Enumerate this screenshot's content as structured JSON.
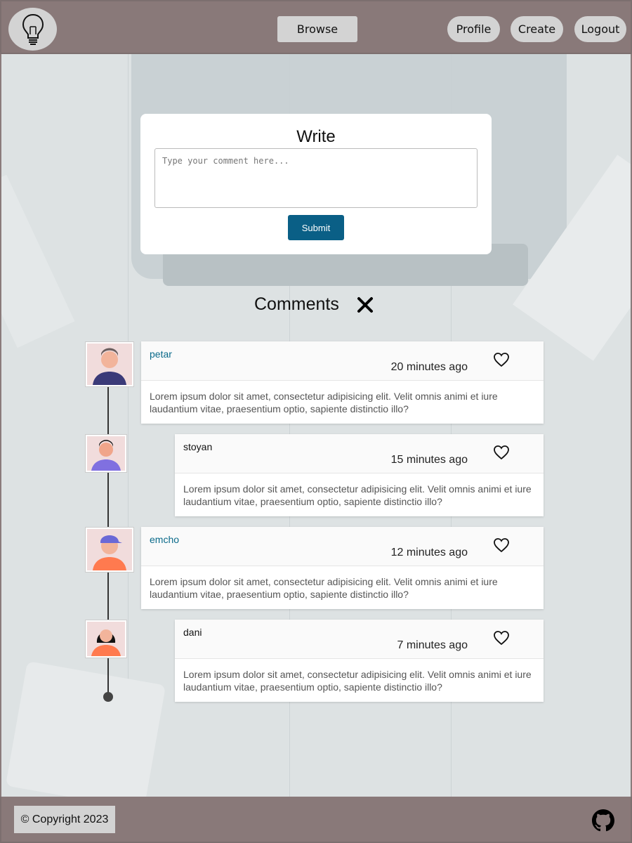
{
  "header": {
    "nav": {
      "browse": "Browse",
      "profile": "Profile",
      "create": "Create",
      "logout": "Logout"
    },
    "logo_icon": "lightbulb-icon"
  },
  "write": {
    "title": "Write",
    "placeholder": "Type your comment here...",
    "submit": "Submit"
  },
  "comments": {
    "title": "Comments",
    "close_icon": "close-icon",
    "items": [
      {
        "user": "petar",
        "time": "20 minutes ago",
        "text": "Lorem ipsum dolor sit amet, consectetur adipisicing elit. Velit omnis animi et iure laudantium vitae, praesentium optio, sapiente distinctio illo?",
        "user_color": "#0a6a8a"
      },
      {
        "user": "stoyan",
        "time": "15 minutes ago",
        "text": "Lorem ipsum dolor sit amet, consectetur adipisicing elit. Velit omnis animi et iure laudantium vitae, praesentium optio, sapiente distinctio illo?",
        "user_color": "#111111"
      },
      {
        "user": "emcho",
        "time": "12 minutes ago",
        "text": "Lorem ipsum dolor sit amet, consectetur adipisicing elit. Velit omnis animi et iure laudantium vitae, praesentium optio, sapiente distinctio illo?",
        "user_color": "#0a6a8a"
      },
      {
        "user": "dani",
        "time": "7 minutes ago",
        "text": "Lorem ipsum dolor sit amet, consectetur adipisicing elit. Velit omnis animi et iure laudantium vitae, praesentium optio, sapiente distinctio illo?",
        "user_color": "#111111"
      }
    ]
  },
  "footer": {
    "copyright": "© Copyright 2023",
    "github_icon": "github-icon"
  },
  "colors": {
    "header_bg": "#897979",
    "nav_button_bg": "#d3d3d3",
    "submit_bg": "#0a5f86",
    "card_bg": "#ffffff"
  }
}
